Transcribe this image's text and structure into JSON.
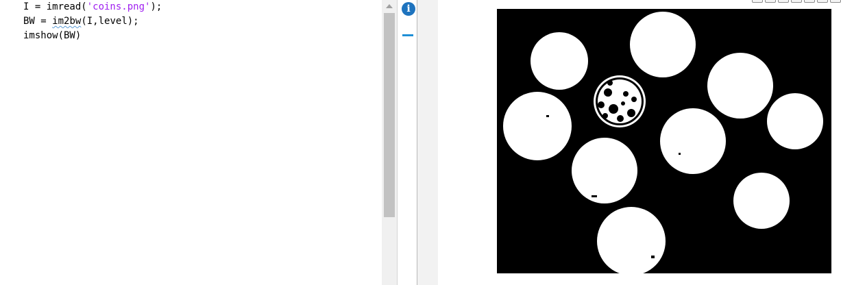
{
  "editor": {
    "lines": [
      {
        "pre": "I = imread(",
        "str": "'coins.png'",
        "post": ");"
      },
      {
        "pre": "BW = ",
        "squiggle": "im2bw",
        "post": "(I,level);"
      },
      {
        "text": "imshow(BW)"
      }
    ]
  },
  "gutter": {
    "info_icon": "i",
    "info_color": "#1e73be",
    "mark_color": "#1f8fd6"
  },
  "figure": {
    "image": "coins.png",
    "toolbar_icons": [
      "save-icon",
      "print-icon",
      "new-figure-icon",
      "pan-hand-icon",
      "zoom-in-icon",
      "zoom-out-icon",
      "home-icon"
    ]
  },
  "colors": {
    "string": "#a020f0",
    "squiggle": "#5b9bd5"
  }
}
